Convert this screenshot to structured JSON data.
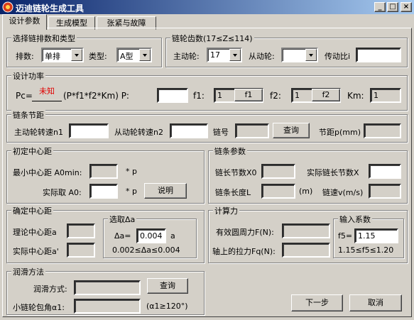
{
  "window": {
    "title": "迈迪链轮生成工具",
    "controls": [
      "minimize-icon",
      "maximize-icon",
      "close-icon"
    ]
  },
  "tabs": [
    "设计参数",
    "生成模型",
    "张紧与故障"
  ],
  "chain_type": {
    "legend": "选择链排数和类型",
    "rows_label": "排数:",
    "rows_value": "单排",
    "type_label": "类型:",
    "type_value": "A型"
  },
  "teeth": {
    "legend": "链轮齿数(17≤Z≤114)",
    "driving_label": "主动轮:",
    "driving_value": "17",
    "driven_label": "从动轮:",
    "driven_value": "",
    "ratio_label": "传动比i",
    "ratio_value": ""
  },
  "power": {
    "legend": "设计功率",
    "formula_prefix": "Pc=",
    "unknown_text": "未知",
    "formula_suffix": "(P*f1*f2*Km) P:",
    "p_value": "",
    "f1_label": "f1:",
    "f1_value": "1",
    "f1_button": "f1",
    "f2_label": "f2:",
    "f2_value": "1",
    "f2_button": "f2",
    "km_label": "Km:",
    "km_value": "1"
  },
  "pitch": {
    "legend": "链条节距",
    "n1_label": "主动轮转速n1",
    "n1_value": "",
    "n2_label": "从动轮转速n2",
    "n2_value": "",
    "chain_no_label": "链号",
    "chain_no_value": "",
    "query_button": "查询",
    "p_label": "节距p(mm)",
    "p_value": ""
  },
  "init_center": {
    "legend": "初定中心距",
    "min_label": "最小中心距  A0min:",
    "min_value": "",
    "min_unit": "* p",
    "actual_label": "实际取  A0:",
    "actual_value": "",
    "actual_unit": "* p",
    "explain_button": "说明"
  },
  "chain_params": {
    "legend": "链条参数",
    "links_label": "链长节数X0",
    "links_value": "",
    "actual_links_label": "实际链长节数X",
    "actual_links_value": "",
    "length_label": "链条长度L",
    "length_value": "",
    "length_unit": "(m)",
    "speed_label": "链速v(m/s)",
    "speed_value": ""
  },
  "confirm_center": {
    "legend": "确定中心距",
    "theory_label": "理论中心距a",
    "theory_value": "",
    "actual_label": "实际中心距a'",
    "actual_value": "",
    "delta_legend": "选取Δa",
    "delta_label": "Δa=",
    "delta_value": "0.004",
    "delta_unit": "a",
    "delta_range": "0.002≤Δa≤0.004"
  },
  "force": {
    "legend": "计算力",
    "effective_label": "有效圆周力F(N):",
    "effective_value": "",
    "shaft_label": "轴上的拉力Fq(N):",
    "shaft_value": "",
    "coef_legend": "输入系数",
    "f5_label": "f5=",
    "f5_value": "1.15",
    "f5_range": "1.15≤f5≤1.20"
  },
  "lube": {
    "legend": "润滑方法",
    "method_label": "润滑方式:",
    "method_value": "",
    "query_button": "查询",
    "angle_label": "小链轮包角α1:",
    "angle_value": "",
    "angle_hint": "(α1≥120°)"
  },
  "footer": {
    "next_button": "下一步",
    "cancel_button": "取消"
  }
}
